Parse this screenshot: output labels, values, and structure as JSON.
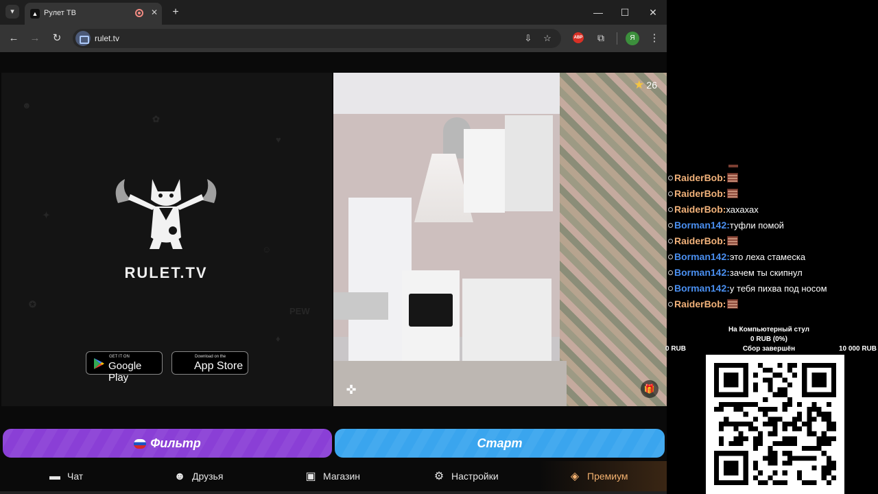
{
  "browser": {
    "tab_title": "Рулет ТВ",
    "tab_favicon": "rulet-favicon",
    "url": "rulet.tv",
    "extension_abp": "ABP",
    "profile_initial": "Я",
    "icons": [
      "tab-list-icon",
      "record-icon",
      "close-icon",
      "new-tab-icon",
      "minimize-icon",
      "maximize-icon",
      "window-close-icon",
      "back-icon",
      "forward-icon",
      "reload-icon",
      "install-app-icon",
      "bookmark-star-icon",
      "extensions-icon",
      "menu-icon"
    ]
  },
  "promo": {
    "logo_text": "RULET.TV",
    "doodle_word": "PEW",
    "google_play_small": "GET IT ON",
    "google_play_big": "Google Play",
    "app_store_small": "Download on the",
    "app_store_big": "App Store"
  },
  "video": {
    "rating": "26"
  },
  "buttons": {
    "filter": "Фильтр",
    "start": "Старт"
  },
  "nav": [
    {
      "label": "Чат",
      "icon": "chat-icon"
    },
    {
      "label": "Друзья",
      "icon": "friends-icon"
    },
    {
      "label": "Магазин",
      "icon": "shop-icon"
    },
    {
      "label": "Настройки",
      "icon": "settings-icon"
    },
    {
      "label": "Премиум",
      "icon": "premium-tag-icon"
    }
  ],
  "chat": {
    "messages": [
      {
        "user": "RaiderBob:",
        "text": "",
        "emote": true
      },
      {
        "user": "RaiderBob:",
        "text": "",
        "emote": true
      },
      {
        "user": "RaiderBob:",
        "text": "хахахах",
        "emote": false
      },
      {
        "user": "Borman142:",
        "text": "туфли помой",
        "emote": false
      },
      {
        "user": "RaiderBob:",
        "text": "",
        "emote": true
      },
      {
        "user": "Borman142:",
        "text": "это леха стамеска",
        "emote": false
      },
      {
        "user": "Borman142:",
        "text": "зачем ты скипнул",
        "emote": false
      },
      {
        "user": "Borman142:",
        "text": "у тебя пихва под носом",
        "emote": false
      },
      {
        "user": "RaiderBob:",
        "text": "",
        "emote": true
      }
    ],
    "colors": {
      "RaiderBob": "#f2b27a",
      "Borman142": "#4a8ff0"
    }
  },
  "donation": {
    "goal": "На Компьютерный стул",
    "progress": "0 RUB (0%)",
    "progress_fraction": 0,
    "min": "0 RUB",
    "status": "Сбор завершён",
    "max": "10 000 RUB"
  },
  "colors": {
    "filter_button": "#8a3fd6",
    "start_button": "#3aa5ee",
    "premium": "#f4b270"
  }
}
